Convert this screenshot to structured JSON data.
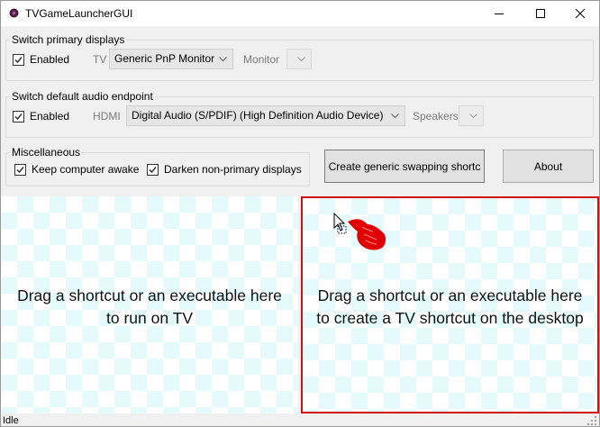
{
  "window": {
    "title": "TVGameLauncherGUI",
    "icon": "gamepad-icon",
    "controls": [
      "minimize-icon",
      "maximize-icon",
      "close-icon"
    ]
  },
  "displays": {
    "group_label": "Switch primary displays",
    "enabled_label": "Enabled",
    "enabled_checked": true,
    "tv_label": "TV",
    "tv_value": "Generic PnP Monitor",
    "monitor_label": "Monitor",
    "monitor_value": ""
  },
  "audio": {
    "group_label": "Switch default audio endpoint",
    "enabled_label": "Enabled",
    "enabled_checked": true,
    "hdmi_label": "HDMI",
    "hdmi_value": "Digital Audio (S/PDIF) (High Definition Audio Device)",
    "speakers_label": "Speakers",
    "speakers_value": ""
  },
  "misc": {
    "group_label": "Miscellaneous",
    "keep_awake_label": "Keep computer awake",
    "keep_awake_checked": true,
    "darken_label": "Darken non-primary displays",
    "darken_checked": true
  },
  "buttons": {
    "create_shortcut_label": "Create generic swapping shortc",
    "about_label": "About"
  },
  "dropzones": {
    "left_line1": "Drag a shortcut or an executable here",
    "left_line2": "to run on TV",
    "right_line1": "Drag a shortcut or an executable here",
    "right_line2": "to create a TV shortcut on the desktop"
  },
  "status": {
    "text": "Idle"
  },
  "colors": {
    "highlight_border": "#d01010",
    "checker": "#e5fbfb",
    "window_bg": "#f0f0f0"
  }
}
